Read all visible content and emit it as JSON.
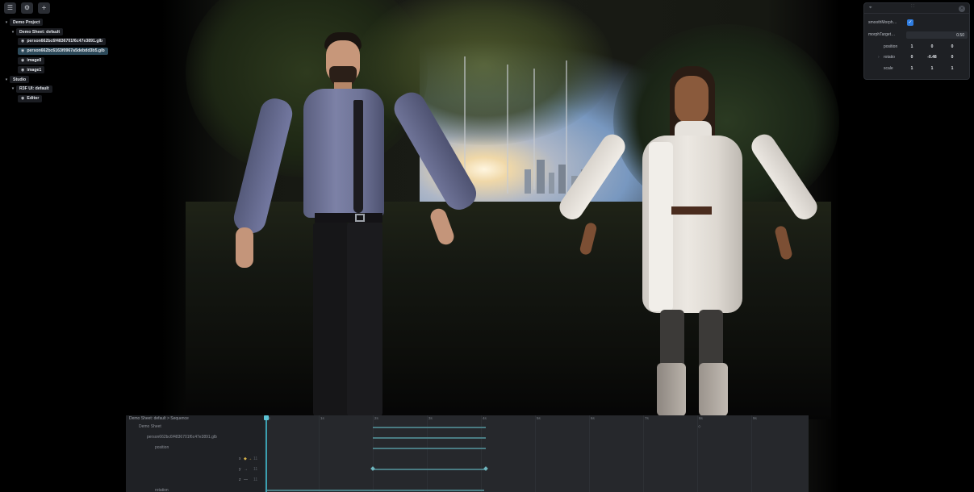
{
  "toolbar": {
    "buttons": [
      {
        "icon": "outline-toggle-icon",
        "glyph": "☰"
      },
      {
        "icon": "settings-icon",
        "glyph": "⚙"
      },
      {
        "icon": "add-icon",
        "glyph": "+"
      }
    ]
  },
  "outline": {
    "project": "Demo Project",
    "sheet": "Demo Sheet: default",
    "objects": [
      "person662bc6f4836701f6c47e3891.glb",
      "person662bc6163f0967a5debdd3b5.glb",
      "image0",
      "image1"
    ],
    "studio": "Studio",
    "r3f": "R3F UI: default",
    "editor": "Editor"
  },
  "details": {
    "header_left": "⌖",
    "header_mid": "::",
    "close_glyph": "×",
    "smooth_label": "smoothMorph…",
    "smooth_checked": "✓",
    "morph_label": "morphTarget…",
    "morph_value": "0.50",
    "position_label": "position",
    "position_values": [
      "1",
      "0",
      "0"
    ],
    "rotation_label": "rotatio",
    "rotation_values": [
      "0",
      "-0.48",
      "0"
    ],
    "scale_label": "scale",
    "scale_values": [
      "1",
      "1",
      "1"
    ]
  },
  "sequence": {
    "title": "Demo Sheet: default > Sequence",
    "sheet_row": "Demo Sheet",
    "object_row": "person662bc6f4836701f6c47e3891.glb",
    "position_row": "position",
    "axes": [
      {
        "label": "x",
        "marker": "◆ →",
        "count": "11"
      },
      {
        "label": "y",
        "marker": "→",
        "count": "11"
      },
      {
        "label": "z",
        "marker": "—",
        "count": "11"
      }
    ],
    "rotation_row": "rotation",
    "ticks": [
      "0s",
      "1s",
      "2s",
      "3s",
      "4s",
      "5s",
      "6s",
      "7s",
      "8s",
      "9s"
    ],
    "marker_glyph": "◇"
  },
  "colors": {
    "accent": "#3b9fb0",
    "panel": "#1e2024",
    "keyframe": "#6fb6bf"
  }
}
